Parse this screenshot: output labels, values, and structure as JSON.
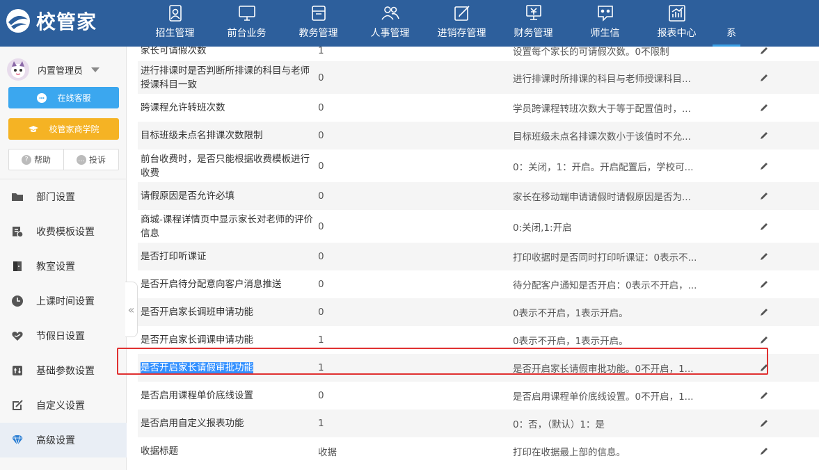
{
  "app": {
    "logo_text": "校管家",
    "brand_color": "#2d5f9c",
    "accent": "#3ba7ef"
  },
  "nav": [
    {
      "label": "招生管理",
      "icon": "enrollment-icon"
    },
    {
      "label": "前台业务",
      "icon": "monitor-icon"
    },
    {
      "label": "教务管理",
      "icon": "archive-box-icon"
    },
    {
      "label": "人事管理",
      "icon": "people-icon"
    },
    {
      "label": "进销存管理",
      "icon": "edit-box-icon"
    },
    {
      "label": "财务管理",
      "icon": "finance-icon"
    },
    {
      "label": "师生信",
      "icon": "chat-icon"
    },
    {
      "label": "报表中心",
      "icon": "report-chart-icon"
    },
    {
      "label": "系",
      "icon": ""
    }
  ],
  "sidebar": {
    "username": "内置管理员",
    "online_service": "在线客服",
    "academy": "校管家商学院",
    "help": "帮助",
    "complaint": "投诉",
    "menu": [
      {
        "label": "部门设置",
        "icon": "folder-icon"
      },
      {
        "label": "收费模板设置",
        "icon": "fee-template-icon"
      },
      {
        "label": "教室设置",
        "icon": "classroom-icon"
      },
      {
        "label": "上课时间设置",
        "icon": "clock-icon"
      },
      {
        "label": "节假日设置",
        "icon": "heart-icon"
      },
      {
        "label": "基础参数设置",
        "icon": "sliders-icon"
      },
      {
        "label": "自定义设置",
        "icon": "custom-edit-icon"
      },
      {
        "label": "高级设置",
        "icon": "diamond-icon"
      }
    ],
    "collapse": "«"
  },
  "table": {
    "rows": [
      {
        "name": "家长可请假次数",
        "value": "1",
        "desc": "设置每个家长的可请假次数。0不限制"
      },
      {
        "name": "进行排课时是否判断所排课的科目与老师授课科目一致",
        "value": "0",
        "desc": "进行排课时所排课的科目与老师授课科目..."
      },
      {
        "name": "跨课程允许转班次数",
        "value": "0",
        "desc": "学员跨课程转班次数大于等于配置值时，..."
      },
      {
        "name": "目标班级未点名排课次数限制",
        "value": "0",
        "desc": "目标班级未点名排课次数小于该值时不允..."
      },
      {
        "name": "前台收费时，是否只能根据收费模板进行收费",
        "value": "0",
        "desc": "0：关闭，1：开启。开启配置后，学校可..."
      },
      {
        "name": "请假原因是否允许必填",
        "value": "0",
        "desc": "家长在移动端申请请假时请假原因是否为..."
      },
      {
        "name": "商城-课程详情页中显示家长对老师的评价信息",
        "value": "0",
        "desc": "0:关闭,1:开启"
      },
      {
        "name": "是否打印听课证",
        "value": "0",
        "desc": "打印收据时是否同时打印听课证：0表示不..."
      },
      {
        "name": "是否开启待分配意向客户消息推送",
        "value": "0",
        "desc": "待分配客户通知是否开启：0表示不开启，..."
      },
      {
        "name": "是否开启家长调班申请功能",
        "value": "0",
        "desc": "0表示不开启，1表示开启。"
      },
      {
        "name": "是否开启家长调课申请功能",
        "value": "1",
        "desc": "0表示不开启，1表示开启。"
      },
      {
        "name": "是否开启家长请假审批功能",
        "value": "1",
        "desc": "是否开启家长请假审批功能。0不开启，1..."
      },
      {
        "name": "是否启用课程单价底线设置",
        "value": "0",
        "desc": "是否启用课程单价底线设置。0不开启，1..."
      },
      {
        "name": "是否启用自定义报表功能",
        "value": "1",
        "desc": "0：否，（默认）1：是"
      },
      {
        "name": "收据标题",
        "value": "收据",
        "desc": "打印在收据最上部的信息。"
      }
    ]
  }
}
